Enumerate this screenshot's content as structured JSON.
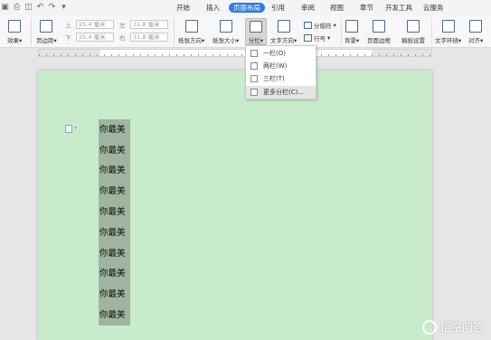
{
  "tabs": [
    "开始",
    "插入",
    "页面布局",
    "引用",
    "审阅",
    "视图",
    "章节",
    "开发工具",
    "云服务"
  ],
  "active_tab": "页面布局",
  "ribbon": {
    "effects": "效果",
    "margin": "页边距",
    "margin_fields": {
      "top_key": "上",
      "top_value": "25.4 毫米",
      "bottom_key": "下",
      "bottom_value": "25.4 毫米",
      "left_key": "左",
      "left_value": "31.8 毫米",
      "right_key": "右",
      "right_value": "31.8 毫米"
    },
    "orientation": "纸张方向",
    "paper_size": "纸张大小",
    "columns": "分栏",
    "text_direction": "文字方向",
    "breaks": "分隔符",
    "line_numbers": "行号",
    "background": "背景",
    "page_border": "页面边框",
    "paper_setup": "稿纸设置",
    "text_wrap": "文字环绕",
    "align": "对齐"
  },
  "columns_menu": {
    "items": [
      "一栏(O)",
      "两栏(W)",
      "三栏(T)",
      "更多分栏(C)..."
    ],
    "hovered_index": 3
  },
  "document": {
    "lines": [
      "你最美",
      "你最美",
      "你最美",
      "你最美",
      "你最美",
      "你最美",
      "你最美",
      "你最美",
      "你最美",
      "你最美"
    ]
  },
  "colors": {
    "page_bg": "#c7ebcb",
    "selection": "#9fb59f",
    "active_tab": "#2f7de1"
  },
  "watermark": "悟空问答"
}
